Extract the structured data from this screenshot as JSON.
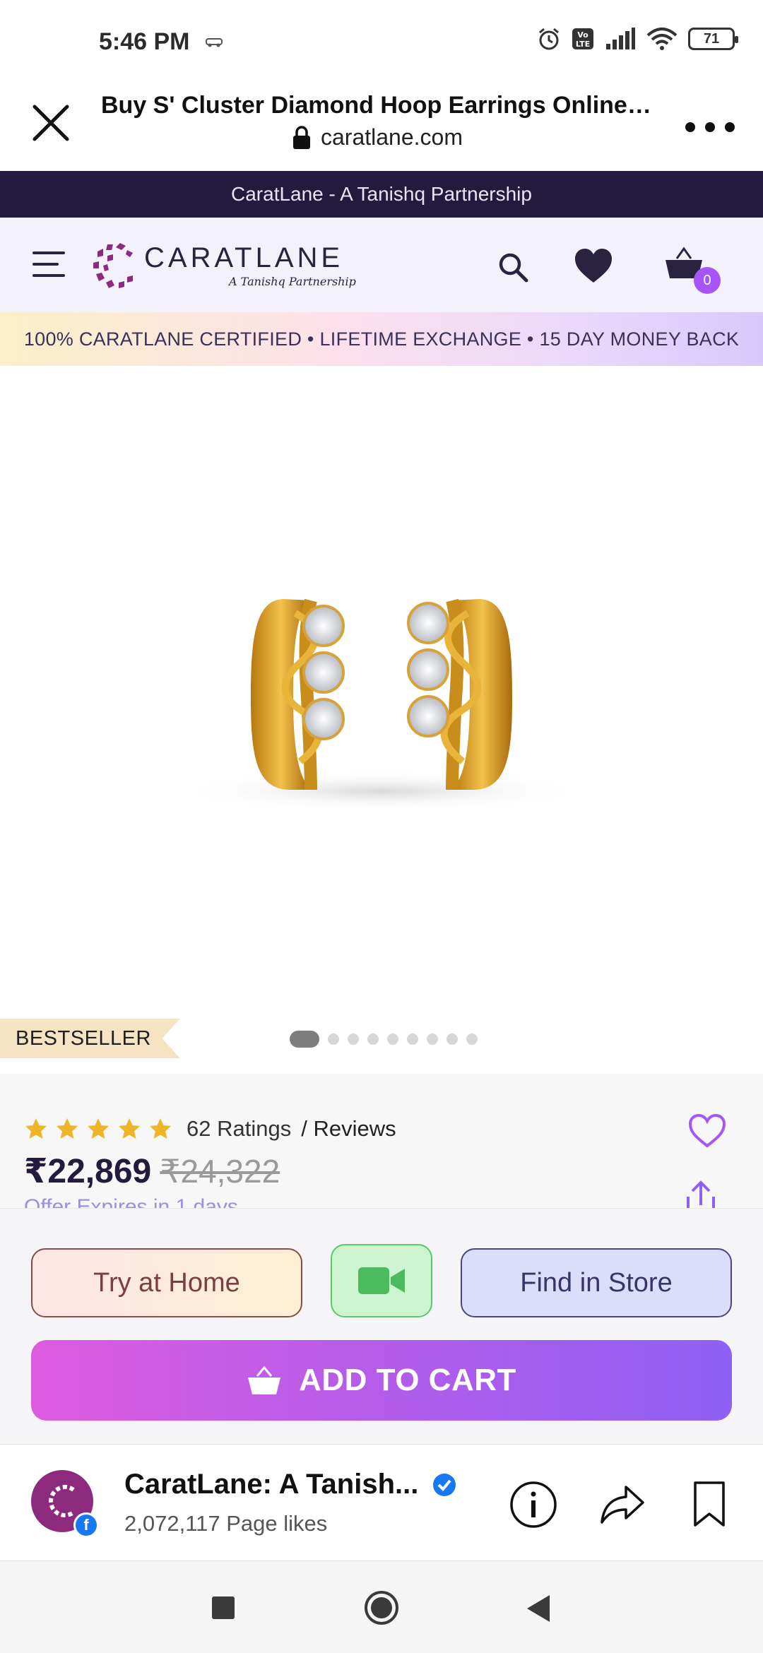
{
  "status_bar": {
    "time": "5:46 PM",
    "battery": "71",
    "icons": [
      "car-icon",
      "alarm-icon",
      "volte-icon",
      "signal-icon",
      "wifi-icon",
      "battery-icon"
    ]
  },
  "browser": {
    "title": "Buy S' Cluster Diamond Hoop Earrings Online |...",
    "url": "caratlane.com"
  },
  "promo": {
    "text": "CaratLane - A Tanishq Partnership"
  },
  "header": {
    "logo_name": "CARATLANE",
    "logo_sub": "A Tanishq Partnership",
    "cart_count": "0"
  },
  "certified": {
    "text": "100% CARATLANE CERTIFIED • LIFETIME EXCHANGE • 15 DAY MONEY BACK"
  },
  "product": {
    "badge": "BESTSELLER",
    "image_count": 9,
    "active_image": 1,
    "rating_stars": 5,
    "ratings_label": "62 Ratings",
    "reviews_label": "/ Reviews",
    "price": "₹22,869",
    "original_price": "₹24,322",
    "offer": "Offer Expires in 1 days"
  },
  "actions": {
    "try_home": "Try at Home",
    "find_store": "Find in Store",
    "add_to_cart": "ADD TO CART"
  },
  "fb_bar": {
    "page_name": "CaratLane: A Tanish...",
    "likes": "2,072,117 Page likes",
    "badge_letter": "f"
  },
  "colors": {
    "brand_dark": "#231a3d",
    "accent_purple": "#a855f7",
    "star_gold": "#f0b429",
    "cart_gradient_start": "#dd5bdf",
    "cart_gradient_end": "#8e60f3",
    "video_green": "#4cbb5f"
  }
}
